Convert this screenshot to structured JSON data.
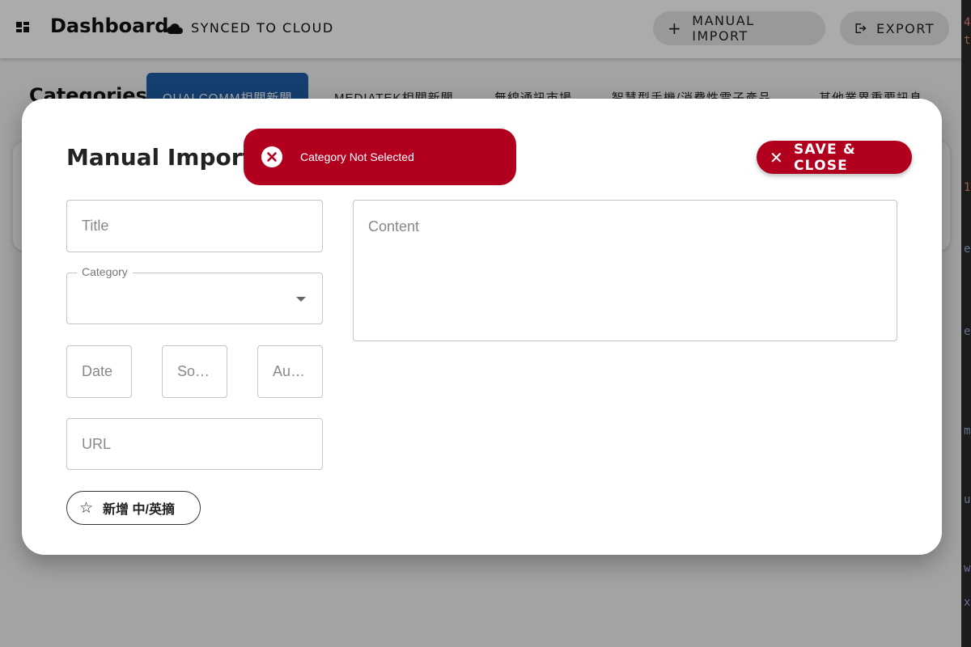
{
  "appbar": {
    "title": "Dashboard",
    "sync_status": "SYNCED TO CLOUD",
    "manual_import_label": "MANUAL IMPORT",
    "export_label": "EXPORT"
  },
  "categories": {
    "label": "Categories:",
    "tabs": [
      {
        "label": "QUALCOMM相關新聞",
        "active": true
      },
      {
        "label": "MEDIATEK相關新聞",
        "active": false
      },
      {
        "label": "無線通訊市場",
        "active": false
      },
      {
        "label": "智慧型手機/消費性電子產品",
        "active": false
      },
      {
        "label": "其他業界重要訊息",
        "active": false
      }
    ]
  },
  "dialog": {
    "title": "Manual Import",
    "toast_message": "Category Not Selected",
    "save_close_label": "SAVE & CLOSE",
    "fields": {
      "title_placeholder": "Title",
      "category_label": "Category",
      "category_value": "",
      "date_placeholder": "Date",
      "source_placeholder": "So…",
      "author_placeholder": "Au…",
      "url_placeholder": "URL",
      "content_placeholder": "Content"
    },
    "add_summary_label": "新增 中/英摘"
  },
  "colors": {
    "accent_red": "#b2001f",
    "tab_active_blue": "#1f5fa8"
  },
  "icons": [
    "grid-icon",
    "cloud-icon",
    "plus-icon",
    "export-icon",
    "error-icon",
    "close-icon",
    "dropdown-caret-icon",
    "star-icon"
  ]
}
